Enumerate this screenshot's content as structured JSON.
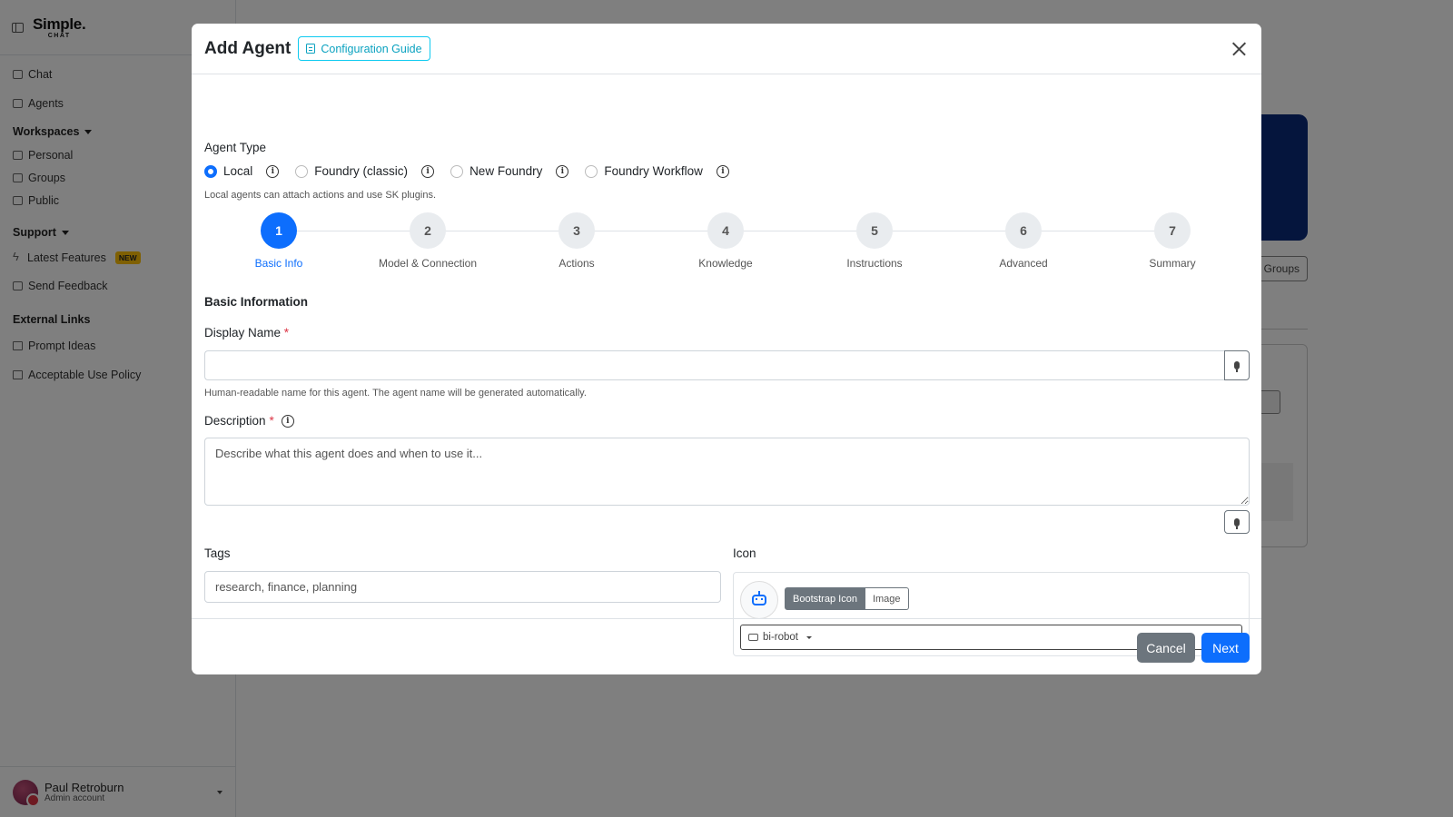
{
  "app": {
    "logo_main": "Simple.",
    "logo_sub": "CHAT"
  },
  "sidebar": {
    "items": [
      {
        "label": "Chat",
        "icon": "chat-icon"
      },
      {
        "label": "Agents",
        "icon": "robot-icon"
      }
    ],
    "workspaces": {
      "label": "Workspaces",
      "items": [
        "Personal",
        "Groups",
        "Public"
      ]
    },
    "support": {
      "label": "Support",
      "latest_features": "Latest Features",
      "new_badge": "NEW",
      "send_feedback": "Send Feedback"
    },
    "external": {
      "label": "External Links",
      "items": [
        "Prompt Ideas",
        "Acceptable Use Policy"
      ]
    },
    "user": {
      "name": "Paul Retroburn",
      "role": "Admin account"
    }
  },
  "background": {
    "groups_button": "Groups"
  },
  "modal": {
    "title": "Add Agent",
    "guide_button": "Configuration Guide",
    "agent_type": {
      "label": "Agent Type",
      "options": [
        "Local",
        "Foundry (classic)",
        "New Foundry",
        "Foundry Workflow"
      ],
      "selected": "Local",
      "help": "Local agents can attach actions and use SK plugins."
    },
    "steps": [
      {
        "number": "1",
        "label": "Basic Info",
        "active": true
      },
      {
        "number": "2",
        "label": "Model & Connection",
        "active": false
      },
      {
        "number": "3",
        "label": "Actions",
        "active": false
      },
      {
        "number": "4",
        "label": "Knowledge",
        "active": false
      },
      {
        "number": "5",
        "label": "Instructions",
        "active": false
      },
      {
        "number": "6",
        "label": "Advanced",
        "active": false
      },
      {
        "number": "7",
        "label": "Summary",
        "active": false
      }
    ],
    "section_title": "Basic Information",
    "display_name": {
      "label": "Display Name",
      "required_mark": "*",
      "value": "",
      "help": "Human-readable name for this agent. The agent name will be generated automatically."
    },
    "description": {
      "label": "Description",
      "required_mark": "*",
      "placeholder": "Describe what this agent does and when to use it..."
    },
    "tags": {
      "label": "Tags",
      "placeholder": "research, finance, planning"
    },
    "icon": {
      "label": "Icon",
      "mode_bootstrap": "Bootstrap Icon",
      "mode_image": "Image",
      "selected": "bi-robot"
    },
    "footer": {
      "cancel": "Cancel",
      "next": "Next"
    }
  },
  "colors": {
    "primary": "#0d6efd",
    "secondary": "#6c757d",
    "info": "#0dcaf0",
    "danger": "#dc3545",
    "warning": "#ffc107"
  }
}
